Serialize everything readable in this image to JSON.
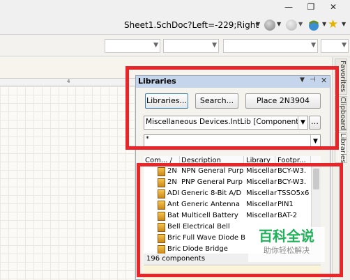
{
  "window": {
    "restore_glyph": "❐",
    "close_glyph": "✕",
    "minimize_glyph": "—"
  },
  "address": {
    "text": "Sheet1.SchDoc?Left=-229;Right"
  },
  "ruler": {
    "mark": "4"
  },
  "side_tabs": [
    "Favorites",
    "Clipboard",
    "Libraries"
  ],
  "panel": {
    "title": "Libraries",
    "buttons": {
      "libraries": "Libraries...",
      "search": "Search...",
      "place": "Place 2N3904"
    },
    "library_select": "Miscellaneous Devices.IntLib [Component Vie",
    "filter_value": "*",
    "more_glyph": "…",
    "columns": [
      "Com... /",
      "Description",
      "Library",
      "Footpr..."
    ],
    "rows": [
      {
        "name": "2N",
        "desc": "NPN General Purp",
        "lib": "Miscellar",
        "fp": "BCY-W3."
      },
      {
        "name": "2N",
        "desc": "PNP General Purp",
        "lib": "Miscellar",
        "fp": "BCY-W3."
      },
      {
        "name": "ADI",
        "desc": "Generic 8-Bit A/D",
        "lib": "Miscellar",
        "fp": "TSSO5x6"
      },
      {
        "name": "Ant",
        "desc": "Generic Antenna",
        "lib": "Miscellar",
        "fp": "PIN1"
      },
      {
        "name": "Bat",
        "desc": "Multicell Battery",
        "lib": "Miscellar",
        "fp": "BAT-2"
      },
      {
        "name": "Bell",
        "desc": "Electrical Bell",
        "lib": "",
        "fp": ""
      },
      {
        "name": "Bric",
        "desc": "Full Wave Diode B",
        "lib": "",
        "fp": ""
      },
      {
        "name": "Bric",
        "desc": "Diode Bridge",
        "lib": "",
        "fp": ""
      }
    ],
    "status": "196 components"
  },
  "watermark": {
    "title": "百科全说",
    "subtitle": "助你轻松解决"
  },
  "colors": {
    "highlight": "#e8262a",
    "panel_header": "#c5d6ec"
  }
}
